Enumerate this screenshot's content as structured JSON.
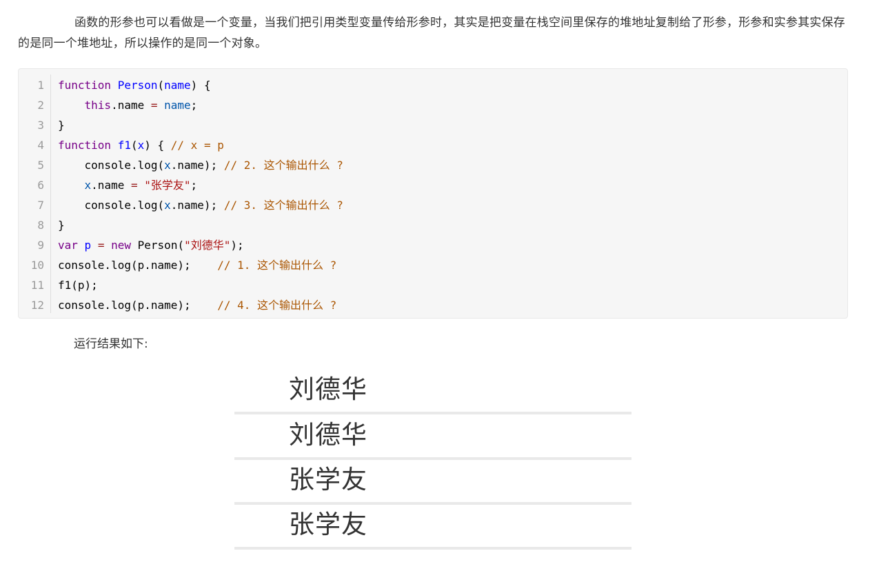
{
  "paragraph": "函数的形参也可以看做是一个变量，当我们把引用类型变量传给形参时，其实是把变量在栈空间里保存的堆地址复制给了形参，形参和实参其实保存的是同一个堆地址，所以操作的是同一个对象。",
  "code": {
    "lines": [
      {
        "n": "1",
        "tokens": [
          [
            "kw",
            "function"
          ],
          [
            "pl",
            " "
          ],
          [
            "def",
            "Person"
          ],
          [
            "pl",
            "("
          ],
          [
            "def",
            "name"
          ],
          [
            "pl",
            ") {"
          ]
        ]
      },
      {
        "n": "2",
        "tokens": [
          [
            "pl",
            "    "
          ],
          [
            "kw",
            "this"
          ],
          [
            "pl",
            ".name "
          ],
          [
            "op",
            "="
          ],
          [
            "pl",
            " "
          ],
          [
            "var",
            "name"
          ],
          [
            "pl",
            ";"
          ]
        ]
      },
      {
        "n": "3",
        "tokens": [
          [
            "pl",
            "}"
          ]
        ]
      },
      {
        "n": "4",
        "tokens": [
          [
            "kw",
            "function"
          ],
          [
            "pl",
            " "
          ],
          [
            "def",
            "f1"
          ],
          [
            "pl",
            "("
          ],
          [
            "def",
            "x"
          ],
          [
            "pl",
            ") { "
          ],
          [
            "cm",
            "// x = p"
          ]
        ]
      },
      {
        "n": "5",
        "tokens": [
          [
            "pl",
            "    console.log("
          ],
          [
            "var",
            "x"
          ],
          [
            "pl",
            ".name); "
          ],
          [
            "cm",
            "// 2. 这个输出什么 ?"
          ]
        ]
      },
      {
        "n": "6",
        "tokens": [
          [
            "pl",
            "    "
          ],
          [
            "var",
            "x"
          ],
          [
            "pl",
            ".name "
          ],
          [
            "op",
            "="
          ],
          [
            "pl",
            " "
          ],
          [
            "str",
            "\"张学友\""
          ],
          [
            "pl",
            ";"
          ]
        ]
      },
      {
        "n": "7",
        "tokens": [
          [
            "pl",
            "    console.log("
          ],
          [
            "var",
            "x"
          ],
          [
            "pl",
            ".name); "
          ],
          [
            "cm",
            "// 3. 这个输出什么 ?"
          ]
        ]
      },
      {
        "n": "8",
        "tokens": [
          [
            "pl",
            "}"
          ]
        ]
      },
      {
        "n": "9",
        "tokens": [
          [
            "kw",
            "var"
          ],
          [
            "pl",
            " "
          ],
          [
            "def",
            "p"
          ],
          [
            "pl",
            " "
          ],
          [
            "op",
            "="
          ],
          [
            "pl",
            " "
          ],
          [
            "kw",
            "new"
          ],
          [
            "pl",
            " Person("
          ],
          [
            "str",
            "\"刘德华\""
          ],
          [
            "pl",
            ");"
          ]
        ]
      },
      {
        "n": "10",
        "tokens": [
          [
            "pl",
            "console.log(p.name);    "
          ],
          [
            "cm",
            "// 1. 这个输出什么 ?"
          ]
        ]
      },
      {
        "n": "11",
        "tokens": [
          [
            "pl",
            "f1(p);"
          ]
        ]
      },
      {
        "n": "12",
        "tokens": [
          [
            "pl",
            "console.log(p.name);    "
          ],
          [
            "cm",
            "// 4. 这个输出什么 ?"
          ]
        ]
      }
    ]
  },
  "result_label": "运行结果如下:",
  "outputs": [
    "刘德华",
    "刘德华",
    "张学友",
    "张学友"
  ],
  "colors": {
    "keyword": "#770088",
    "definition": "#0000ff",
    "variable": "#0055aa",
    "string": "#aa1111",
    "comment": "#aa5500"
  }
}
